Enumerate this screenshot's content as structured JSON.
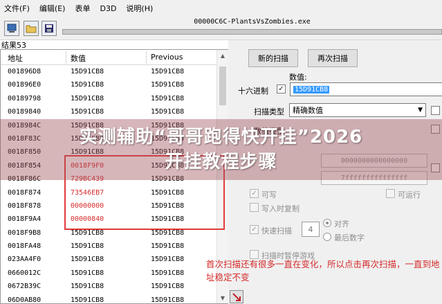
{
  "menu": [
    "文件(F)",
    "编辑(E)",
    "表单",
    "D3D",
    "说明(H)"
  ],
  "toolbar": {
    "process_label": "00000C6C-PlantsVsZombies.exe",
    "icons": [
      "computer-icon",
      "open-folder-icon",
      "save-disk-icon"
    ]
  },
  "results": {
    "count_label": "结果53",
    "columns": [
      "地址",
      "数值",
      "Previous"
    ],
    "rows": [
      {
        "address": "001896D8",
        "value": "15D91CB8",
        "previous": "15D91CB8"
      },
      {
        "address": "001896E0",
        "value": "15D91CB8",
        "previous": "15D91CB8"
      },
      {
        "address": "00189798",
        "value": "15D91CB8",
        "previous": "15D91CB8"
      },
      {
        "address": "00189840",
        "value": "15D91CB8",
        "previous": "15D91CB8"
      },
      {
        "address": "0018984C",
        "value": "15D91CB8",
        "previous": "15D91CB8"
      },
      {
        "address": "0018F83C",
        "value": "15D91CB8",
        "previous": "15D91CB8"
      },
      {
        "address": "0018F850",
        "value": "15D91CB8",
        "previous": "15D91CB8"
      },
      {
        "address": "0018F854",
        "value": "0018F9F0",
        "previous": "15D91CB8",
        "changed": true
      },
      {
        "address": "0018F86C",
        "value": "729BC439",
        "previous": "15D91CB8",
        "changed": true
      },
      {
        "address": "0018F874",
        "value": "73546EB7",
        "previous": "15D91CB8",
        "changed": true
      },
      {
        "address": "0018F878",
        "value": "00000000",
        "previous": "15D91CB8",
        "changed": true
      },
      {
        "address": "0018F9A4",
        "value": "00000840",
        "previous": "15D91CB8",
        "changed": true
      },
      {
        "address": "0018F9B8",
        "value": "15D91CB8",
        "previous": "15D91CB8"
      },
      {
        "address": "0018FA48",
        "value": "15D91CB8",
        "previous": "15D91CB8"
      },
      {
        "address": "023AA4F0",
        "value": "15D91CB8",
        "previous": "15D91CB8"
      },
      {
        "address": "0660012C",
        "value": "15D91CB8",
        "previous": "15D91CB8"
      },
      {
        "address": "0672B39C",
        "value": "15D91CB8",
        "previous": "15D91CB8"
      },
      {
        "address": "06D0AB80",
        "value": "15D91CB8",
        "previous": "15D91CB8"
      }
    ]
  },
  "scan": {
    "new_scan": "新的扫描",
    "next_scan": "再次扫描",
    "value_label": "数值:",
    "hex_label": "十六进制",
    "hex_checked": true,
    "value_input": "15D91CB8",
    "scan_type_label": "扫描类型",
    "scan_type": "精确数值",
    "value_type_label": "数值类型",
    "memory_start": "0000000000000000",
    "memory_end": "7fffffffffffffff",
    "writable": "可写",
    "executable": "可运行",
    "copy_on_write": "写入时复制",
    "fast_scan": "快速扫描",
    "fast_scan_value": "4",
    "align": "对齐",
    "last_digits": "最后数字",
    "pause_game": "扫描时暂停游戏"
  },
  "annotation": "首次扫描还有很多一直在变化，所以点击再次扫描，一直到地址稳定不变",
  "overlay": {
    "line1": "实测辅助“哥哥跑得快开挂”2026",
    "line2": "开挂教程步骤"
  },
  "colors": {
    "highlight_red": "#e23a3a",
    "overlay_band": "#a0505a",
    "selection_blue": "#3399ff"
  }
}
